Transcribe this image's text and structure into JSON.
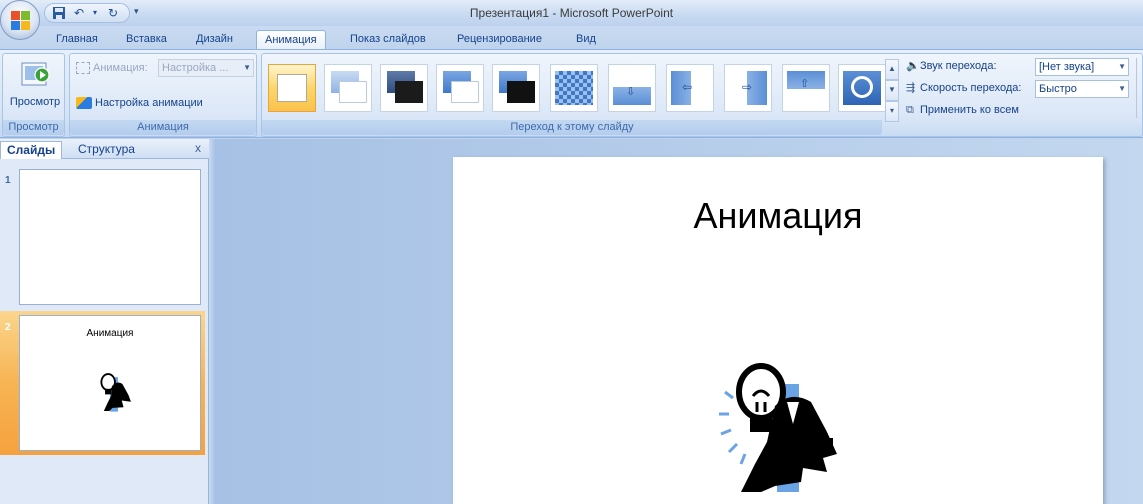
{
  "window": {
    "title": "Презентация1 - Microsoft PowerPoint"
  },
  "quick_access": {
    "items": [
      "save-icon",
      "undo-icon",
      "redo-icon"
    ]
  },
  "tabs": [
    {
      "label": "Главная",
      "active": false
    },
    {
      "label": "Вставка",
      "active": false
    },
    {
      "label": "Дизайн",
      "active": false
    },
    {
      "label": "Анимация",
      "active": true
    },
    {
      "label": "Показ слайдов",
      "active": false
    },
    {
      "label": "Рецензирование",
      "active": false
    },
    {
      "label": "Вид",
      "active": false
    }
  ],
  "ribbon": {
    "preview_group": {
      "button_label": "Просмотр",
      "group_label": "Просмотр"
    },
    "animation_group": {
      "animation_label": "Анимация:",
      "animation_value": "Настройка ...",
      "custom_animation_label": "Настройка анимации",
      "group_label": "Анимация"
    },
    "transition_group": {
      "group_label": "Переход к этому слайду",
      "sound_label": "Звук перехода:",
      "sound_value": "[Нет звука]",
      "speed_label": "Скорость перехода:",
      "speed_value": "Быстро",
      "apply_all_label": "Применить ко всем"
    }
  },
  "slides_pane": {
    "tabs": [
      "Слайды",
      "Структура"
    ],
    "active_tab": "Слайды",
    "close": "x",
    "slides": [
      {
        "number": "1",
        "title": ""
      },
      {
        "number": "2",
        "title": "Анимация",
        "selected": true
      }
    ]
  },
  "current_slide": {
    "title": "Анимация"
  },
  "colors": {
    "accent": "#15428b",
    "selection": "#f7b453",
    "ribbon": "#dbe7f7"
  }
}
